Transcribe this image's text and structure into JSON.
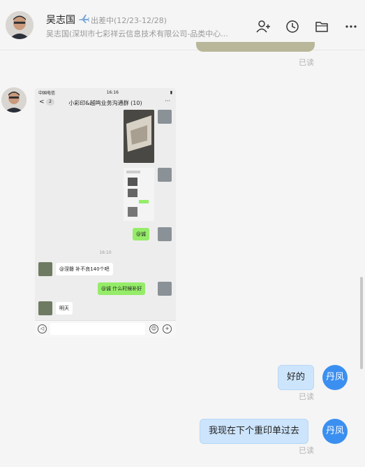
{
  "header": {
    "contact_name": "吴志国",
    "status_text": "出差中(12/23-12/28)",
    "organization": "吴志国(深圳市七彩祥云信息技术有限公司-品类中心...",
    "icons": [
      "add-member-icon",
      "history-icon",
      "folder-icon",
      "more-icon"
    ]
  },
  "window_controls": [
    "minimize-icon",
    "maximize-icon",
    "close-icon"
  ],
  "previous_message": {
    "read_label": "已读"
  },
  "screenshot_message": {
    "status_left": "中国电信",
    "status_time": "16:16",
    "back_label": "<",
    "unread_count": "2",
    "group_title": "小彩印&越鸣业务沟通群 (10)",
    "more_label": "···",
    "msg_at_cheng": "@诚",
    "timestamp": "16:10",
    "msg_bad_140": "@涅磐  补不良140个吧",
    "msg_when": "@诚 什么时候补好",
    "msg_tomorrow": "明天"
  },
  "my_messages": [
    {
      "text": "好的",
      "read_label": "已读"
    },
    {
      "text": "我现在下个重印单过去",
      "read_label": "已读"
    }
  ],
  "me": {
    "avatar_label": "丹凤"
  },
  "colors": {
    "my_bubble": "#cde5fc",
    "my_avatar": "#3b8ff0",
    "wechat_green": "#95ec69"
  }
}
